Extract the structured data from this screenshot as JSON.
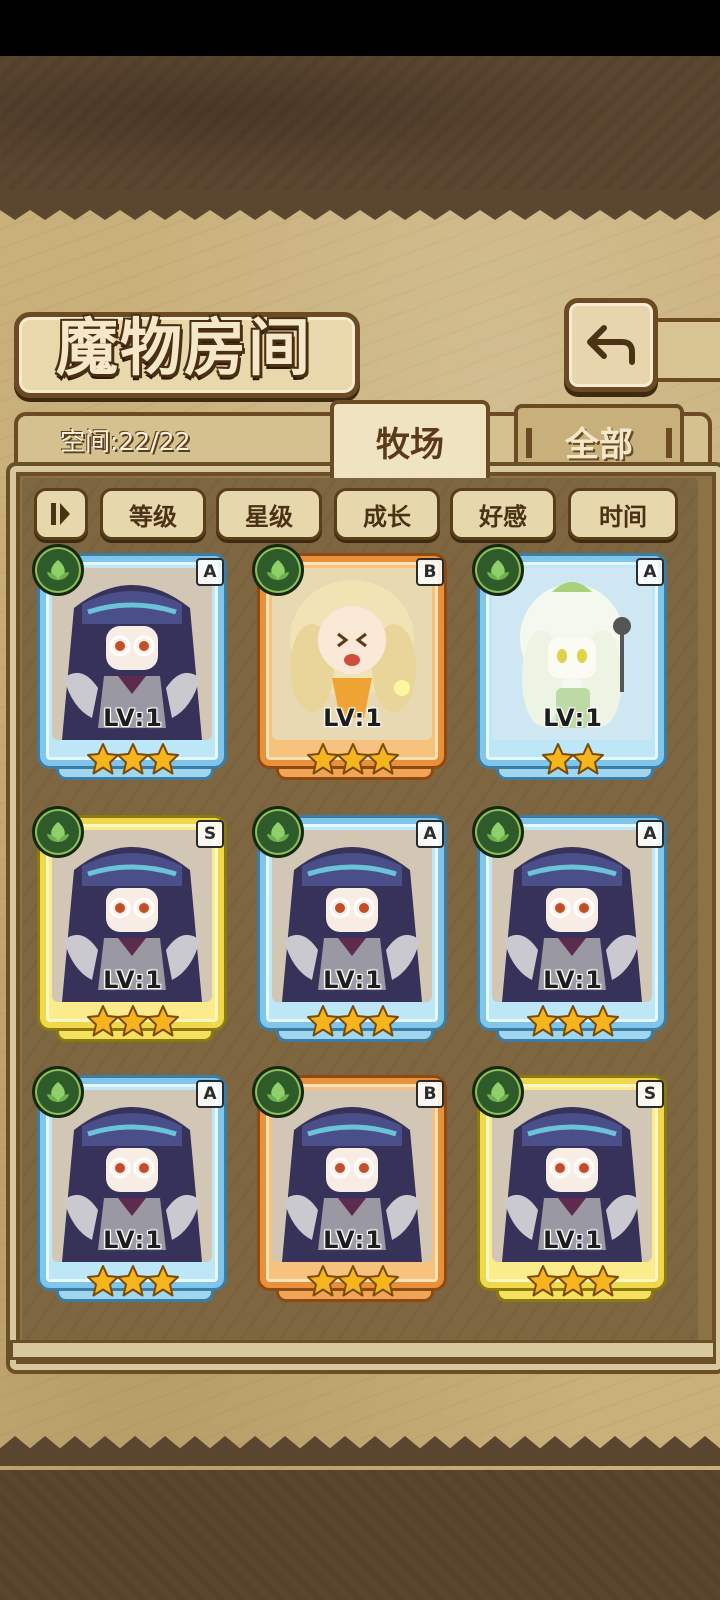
{
  "screen": {
    "title": "魔物房间",
    "space_label": "空间:22/22"
  },
  "tabs": [
    {
      "label": "牧场",
      "active": true
    },
    {
      "label": "全部",
      "active": false
    }
  ],
  "sort_buttons": [
    {
      "label": "等级"
    },
    {
      "label": "星级"
    },
    {
      "label": "成长"
    },
    {
      "label": "好感"
    },
    {
      "label": "时间"
    }
  ],
  "icons": {
    "back": "return-arrow-icon",
    "sort_order": "sort-order-icon",
    "element": "leaf-icon",
    "rating": "star-icon"
  },
  "colors": {
    "rank_A": "#7fc6ea",
    "rank_B": "#e8913a",
    "rank_S": "#f0d84a",
    "star": "#f7b51d"
  },
  "monsters": [
    {
      "rank": "A",
      "level": "LV:1",
      "stars": 3,
      "character": "harpy"
    },
    {
      "rank": "B",
      "level": "LV:1",
      "stars": 3,
      "character": "fairy"
    },
    {
      "rank": "A",
      "level": "LV:1",
      "stars": 2,
      "character": "radish"
    },
    {
      "rank": "S",
      "level": "LV:1",
      "stars": 3,
      "character": "harpy"
    },
    {
      "rank": "A",
      "level": "LV:1",
      "stars": 3,
      "character": "harpy"
    },
    {
      "rank": "A",
      "level": "LV:1",
      "stars": 3,
      "character": "harpy"
    },
    {
      "rank": "A",
      "level": "LV:1",
      "stars": 3,
      "character": "harpy"
    },
    {
      "rank": "B",
      "level": "LV:1",
      "stars": 3,
      "character": "harpy"
    },
    {
      "rank": "S",
      "level": "LV:1",
      "stars": 3,
      "character": "harpy"
    }
  ]
}
